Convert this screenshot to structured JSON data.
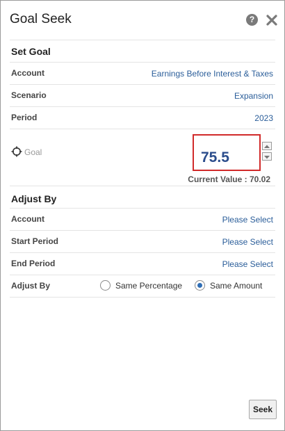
{
  "dialog": {
    "title": "Goal Seek",
    "help_icon_glyph": "?"
  },
  "set_goal": {
    "heading": "Set Goal",
    "rows": [
      {
        "label": "Account",
        "value": "Earnings Before Interest & Taxes"
      },
      {
        "label": "Scenario",
        "value": "Expansion"
      },
      {
        "label": "Period",
        "value": "2023"
      }
    ],
    "goal_label": "Goal",
    "goal_value": "75.5",
    "current_value_text": "Current Value : 70.02"
  },
  "adjust_by": {
    "heading": "Adjust By",
    "rows": [
      {
        "label": "Account",
        "value": "Please Select"
      },
      {
        "label": "Start Period",
        "value": "Please Select"
      },
      {
        "label": "End Period",
        "value": "Please Select"
      }
    ],
    "mode_label": "Adjust By",
    "options": [
      {
        "label": "Same Percentage",
        "selected": false
      },
      {
        "label": "Same Amount",
        "selected": true
      }
    ]
  },
  "buttons": {
    "seek_label": "Seek"
  },
  "colors": {
    "link": "#2a5d99",
    "goal_border": "#d12a2a",
    "goal_text": "#2b4d8c",
    "radio_selected": "#2f6eb5"
  }
}
